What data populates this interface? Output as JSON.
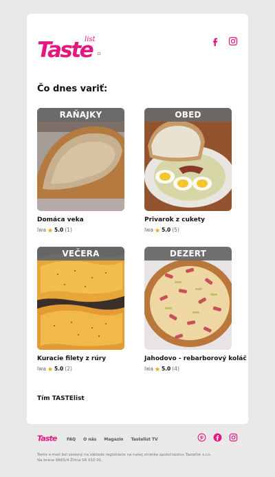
{
  "brand": {
    "logo_text": "Taste",
    "logo_sub": "list",
    "color": "#e3177e"
  },
  "header": {
    "social": [
      "facebook-icon",
      "instagram-icon"
    ]
  },
  "intro": {
    "heading": "Čo dnes variť:"
  },
  "recipes": [
    {
      "category": "RAŇAJKY",
      "title": "Domáca veka",
      "author": "Iwa",
      "score": "5.0",
      "count": "(1)"
    },
    {
      "category": "OBED",
      "title": "Privarok z cukety",
      "author": "Iwa",
      "score": "5.0",
      "count": "(5)"
    },
    {
      "category": "VEČERA",
      "title": "Kuracie filety z rúry",
      "author": "Iwa",
      "score": "5.0",
      "count": "(2)"
    },
    {
      "category": "DEZERT",
      "title": "Jahodovo - rebarborový koláč",
      "author": "Iwa",
      "score": "5.0",
      "count": "(4)"
    }
  ],
  "signature": "Tím TASTElist",
  "footer": {
    "nav": [
      "FAQ",
      "O nás",
      "Magazín",
      "Tastelist TV"
    ],
    "social": [
      "pinterest-icon",
      "facebook-icon",
      "instagram-icon"
    ],
    "legal": "Tento e-mail bol zaslaný na základe registrácie na našej stránke spoločnostou Tastelist s.r.o. Na bráne 8665/4 Žilina SR 010 01."
  },
  "colors": {
    "accent": "#e3177e",
    "category_bar": "#696969",
    "star": "#f5a623",
    "background": "#e9e9e9"
  }
}
